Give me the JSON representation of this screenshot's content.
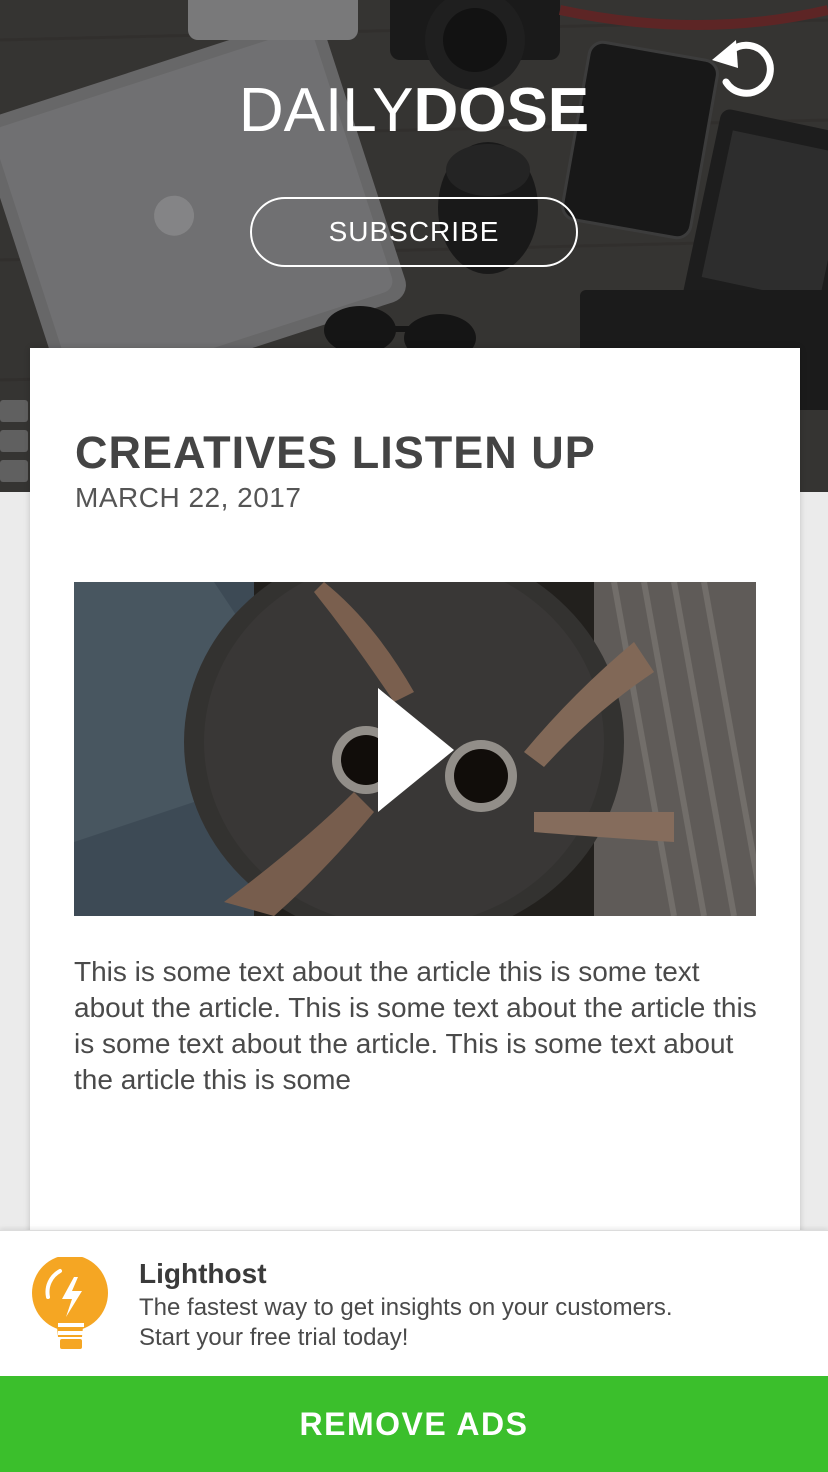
{
  "header": {
    "brand_light": "DAILY",
    "brand_bold": "DOSE",
    "subscribe_label": "SUBSCRIBE",
    "refresh_icon": "refresh-icon"
  },
  "article": {
    "title": "CREATIVES LISTEN UP",
    "date": "MARCH 22, 2017",
    "video_icon": "play-icon",
    "body": "This is some text about the article this is some text about the article. This is some text about the article this is some text about the article. This is some text about the article this is some"
  },
  "ad": {
    "name": "Lighthost",
    "copy_line1": "The fastest way to get insights on your customers.",
    "copy_line2": "Start your free trial today!",
    "icon": "lightbulb-icon"
  },
  "footer": {
    "remove_ads_label": "REMOVE ADS"
  },
  "colors": {
    "accent_green": "#3bbf2c",
    "ad_icon_orange": "#f5a623",
    "background": "#ebebeb",
    "card": "#ffffff",
    "text": "#444444"
  }
}
